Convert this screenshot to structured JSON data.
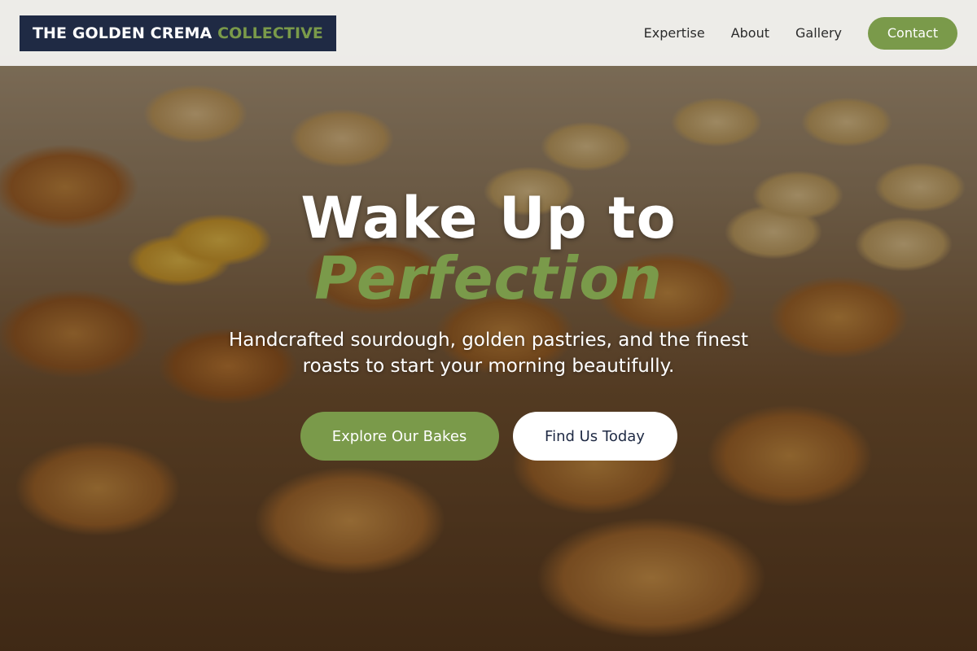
{
  "header": {
    "logo": {
      "main": "THE GOLDEN CREMA",
      "accent": "COLLECTIVE"
    },
    "nav": [
      {
        "label": "Expertise"
      },
      {
        "label": "About"
      },
      {
        "label": "Gallery"
      }
    ],
    "contact_label": "Contact"
  },
  "hero": {
    "headline": "Wake Up to",
    "headline_accent": "Perfection",
    "subtitle": "Handcrafted sourdough, golden pastries, and the finest roasts to start your morning beautifully.",
    "primary_cta": "Explore Our Bakes",
    "secondary_cta": "Find Us Today"
  },
  "colors": {
    "brand_navy": "#1f2a44",
    "accent_green": "#7a9a4a",
    "header_bg": "#f5f5f3",
    "button_white": "#ffffff"
  }
}
